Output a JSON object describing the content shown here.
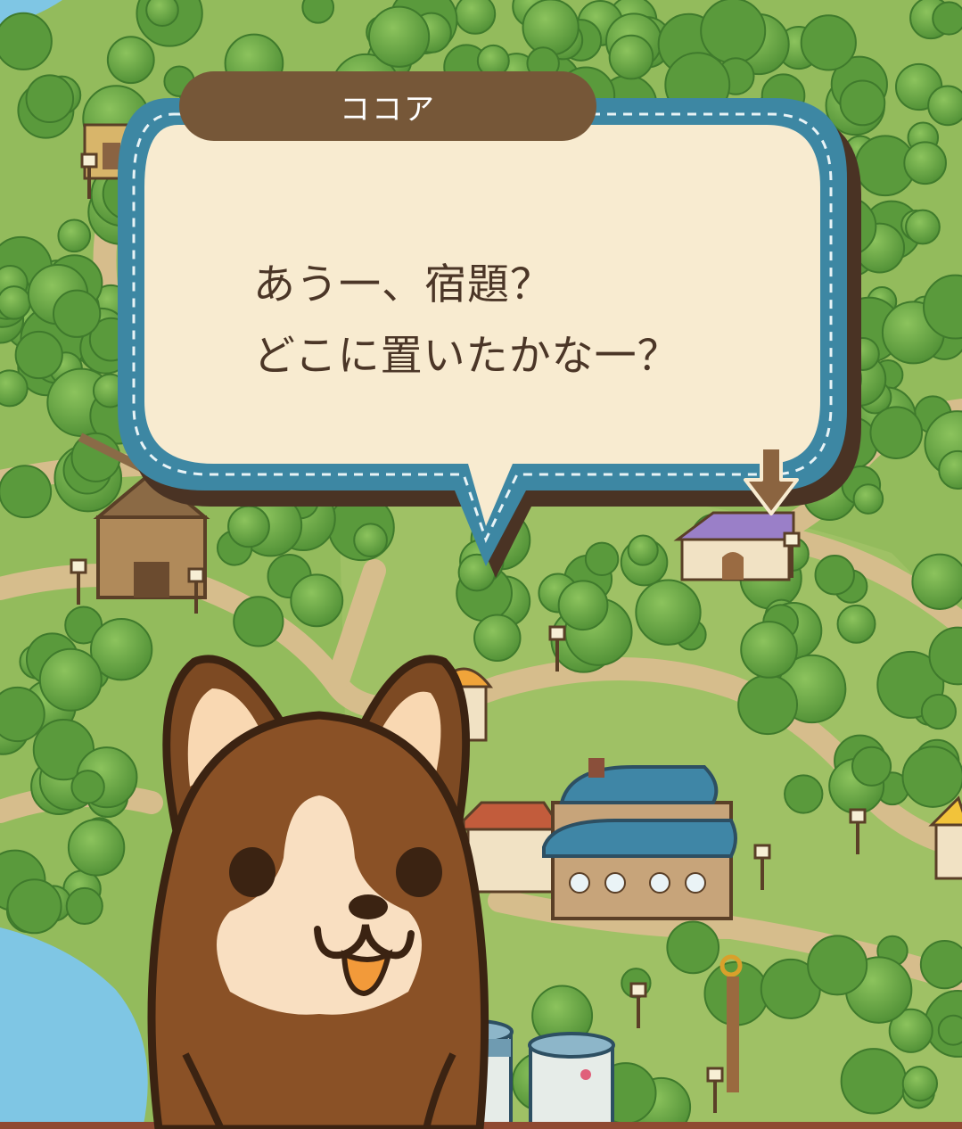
{
  "dialog": {
    "speaker": "ココア",
    "line1": "あう一、宿題？",
    "line2": "どこに置いたかな一？"
  },
  "character": {
    "name": "ココア",
    "icon": "brown-dog-character"
  },
  "indicator": {
    "icon": "next-arrow-icon"
  },
  "colors": {
    "bubble_fill": "#f8ebd0",
    "bubble_border": "#3d87a3",
    "bubble_shadow": "#4a3324",
    "name_plate": "#765738",
    "text": "#4b3627",
    "grass": "#8fb85a",
    "path": "#d4b98a",
    "water": "#7fc6e4"
  }
}
